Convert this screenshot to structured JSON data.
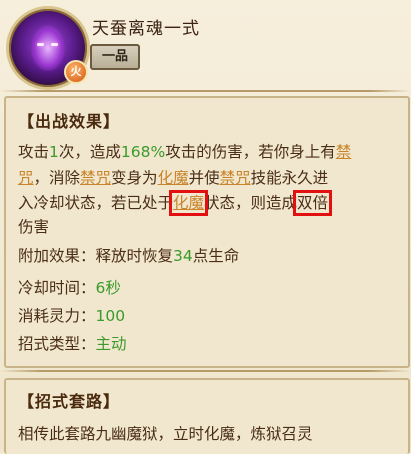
{
  "header": {
    "skill_name": "天蚕离魂一式",
    "grade": "一品",
    "element_badge": "火",
    "icon": "demon-skill-icon"
  },
  "battle_effect": {
    "title": "【出战效果】",
    "line1_a": "攻击",
    "line1_b": "1",
    "line1_c": "次，造成",
    "line1_d": "168%",
    "line1_e": "攻击的伤害，若你身上有",
    "line1_f": "禁",
    "line2_a": "咒",
    "line2_b": "，消除",
    "line2_c": "禁咒",
    "line2_d": "变身为",
    "line2_e": "化魔",
    "line2_f": "并使",
    "line2_g": "禁咒",
    "line2_h": "技能永久进",
    "line3_a": "入冷却状态，若已处于",
    "line3_b": "化魔",
    "line3_c": "状态，则造成",
    "line3_d": "双倍",
    "line4": "伤害",
    "extra_a": "附加效果：释放时恢复",
    "extra_b": "34",
    "extra_c": "点生命",
    "cooldown_label": "冷却时间：",
    "cooldown_value": "6秒",
    "cost_label": "消耗灵力：",
    "cost_value": "100",
    "type_label": "招式类型：",
    "type_value": "主动"
  },
  "combo": {
    "title": "【招式套路】",
    "text": "相传此套路九幽魔狱，立时化魔，炼狱召灵"
  },
  "colors": {
    "highlight_box": "#e21010",
    "green_value": "#3b9a2a",
    "keyword_link": "#c8842a"
  }
}
